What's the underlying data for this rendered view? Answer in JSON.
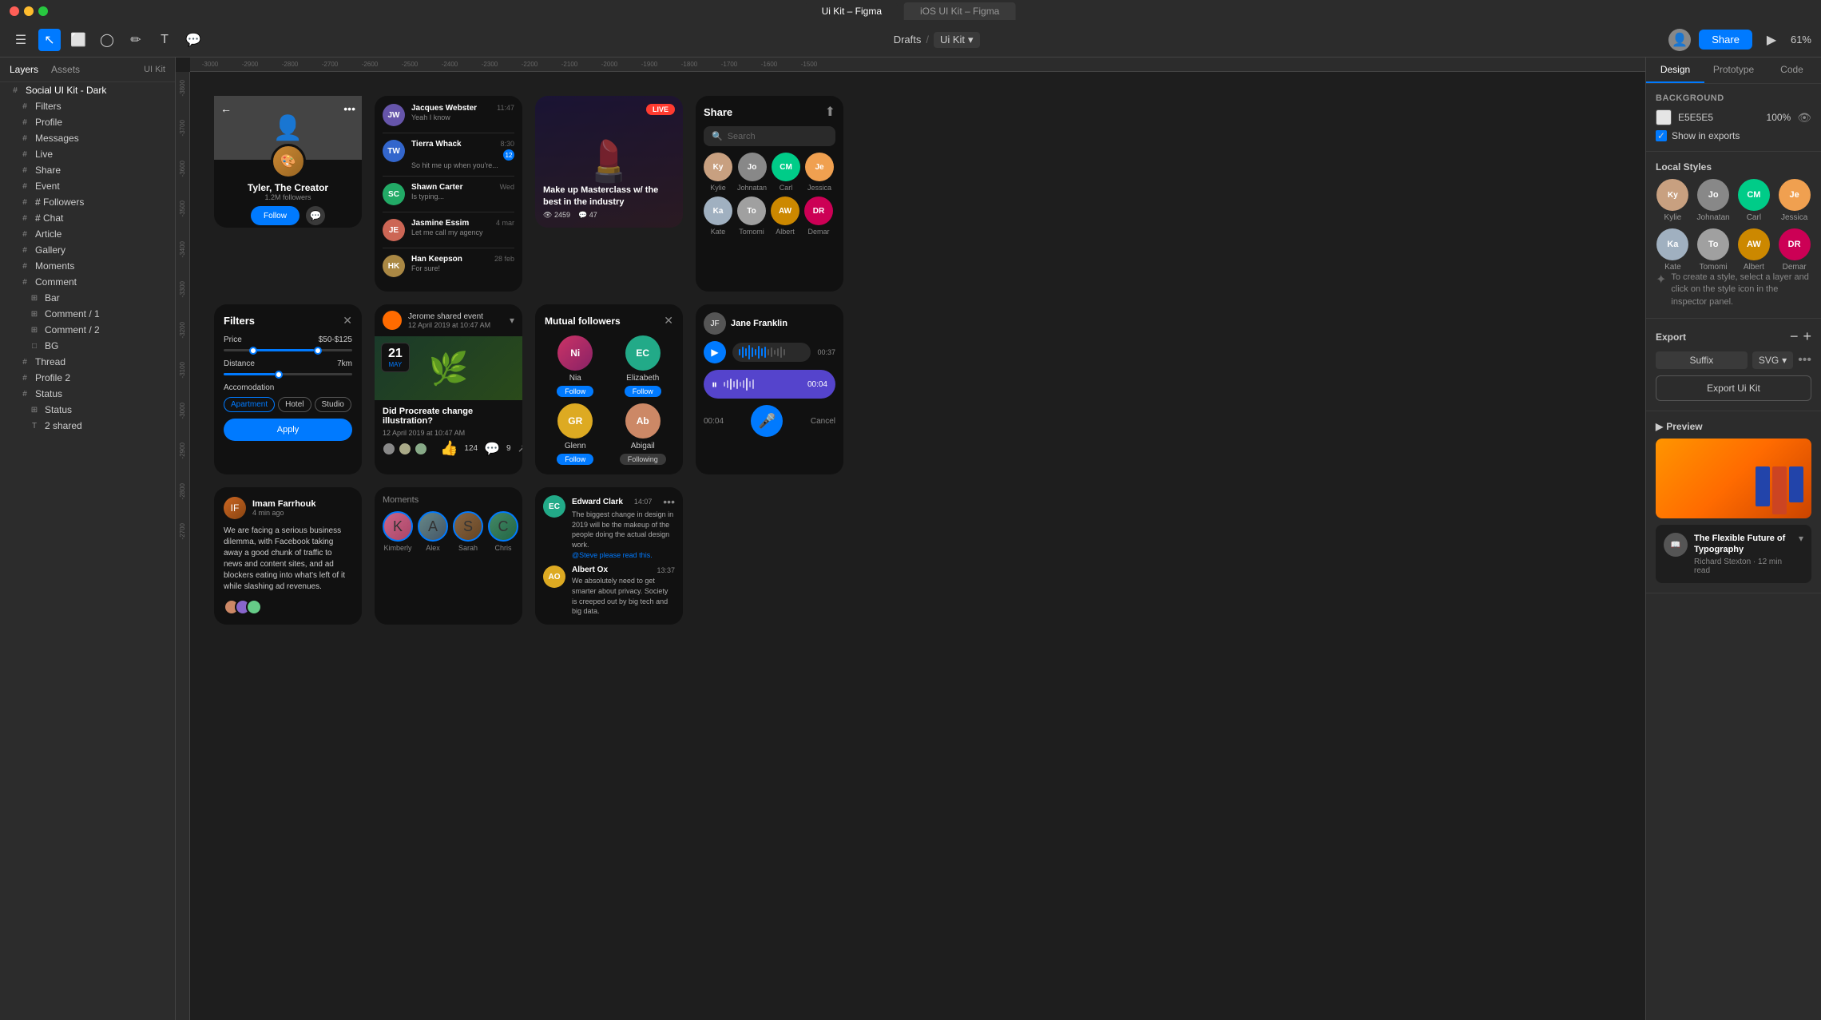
{
  "titlebar": {
    "title": "Ui Kit – Figma",
    "tab1": "Ui Kit – Figma",
    "tab2": "iOS UI Kit – Figma"
  },
  "toolbar": {
    "breadcrumb_drafts": "Drafts",
    "breadcrumb_sep": "/",
    "breadcrumb_current": "Ui Kit",
    "zoom": "61%",
    "share_btn": "Share"
  },
  "left_panel": {
    "tab_layers": "Layers",
    "tab_assets": "Assets",
    "ui_kit_label": "UI Kit",
    "root_item": "Social UI Kit - Dark",
    "items": [
      {
        "label": "Filters",
        "indent": 1
      },
      {
        "label": "Profile",
        "indent": 1
      },
      {
        "label": "Messages",
        "indent": 1
      },
      {
        "label": "Live",
        "indent": 1
      },
      {
        "label": "Share",
        "indent": 1
      },
      {
        "label": "Event",
        "indent": 1
      },
      {
        "label": "Followers",
        "indent": 1
      },
      {
        "label": "Chat",
        "indent": 1
      },
      {
        "label": "Article",
        "indent": 1
      },
      {
        "label": "Gallery",
        "indent": 1
      },
      {
        "label": "Moments",
        "indent": 1
      },
      {
        "label": "Comment",
        "indent": 1
      },
      {
        "label": "Bar",
        "indent": 2
      },
      {
        "label": "Comment / 1",
        "indent": 2
      },
      {
        "label": "Comment / 2",
        "indent": 2
      },
      {
        "label": "BG",
        "indent": 2
      },
      {
        "label": "Thread",
        "indent": 1
      },
      {
        "label": "Profile 2",
        "indent": 1
      },
      {
        "label": "Status",
        "indent": 1
      },
      {
        "label": "Status",
        "indent": 2
      },
      {
        "label": "2 shared",
        "indent": 2
      }
    ]
  },
  "right_panel": {
    "tab_design": "Design",
    "tab_prototype": "Prototype",
    "tab_code": "Code",
    "background_label": "Background",
    "bg_color": "E5E5E5",
    "bg_opacity": "100%",
    "show_exports": "Show in exports",
    "local_styles_label": "Local Styles",
    "styles_hint": "To create a style, select a layer and click on the style icon in the inspector panel.",
    "avatars": [
      {
        "name": "Kylie",
        "color": "#c8a080"
      },
      {
        "name": "Johnatan",
        "color": "#888"
      },
      {
        "name": "Carl",
        "bg": "#00cc88",
        "initials": "CM"
      },
      {
        "name": "Jessica",
        "color": "#f0a050"
      },
      {
        "name": "Kate",
        "color": "#a0b0c0"
      },
      {
        "name": "Tomomi",
        "color": "#a0a0a0"
      },
      {
        "name": "Albert",
        "bg": "#cc8800",
        "initials": "AW"
      },
      {
        "name": "Demar",
        "bg": "#cc0055",
        "initials": "DR"
      }
    ],
    "export_label": "Export",
    "suffix_label": "Suffix",
    "format_label": "SVG",
    "export_btn": "Export Ui Kit",
    "preview_label": "Preview",
    "article_title": "The Flexible Future of Typography",
    "article_meta": "Richard Stexton · 12 min read"
  },
  "canvas": {
    "rulers": [
      "-3000",
      "-2900",
      "-2800",
      "-2700",
      "-2600",
      "-2500",
      "-2400",
      "-2300",
      "-2200",
      "-2100",
      "-2000",
      "-1900",
      "-1800",
      "-1700",
      "-1600",
      "-1500"
    ],
    "profile": {
      "name": "Tyler, The Creator",
      "followers": "1.2M followers",
      "follow_btn": "Follow"
    },
    "messages": [
      {
        "name": "Jacques Webster",
        "text": "Yeah I know",
        "time": "11:47",
        "avatar_color": "#6655aa"
      },
      {
        "name": "Tierra Whack",
        "initials": "TW",
        "text": "So hit me up when you're...",
        "time": "8:30",
        "avatar_color": "#3366cc",
        "badge": "12"
      },
      {
        "name": "Shawn Carter",
        "initials": "SC",
        "text": "Is typing...",
        "time": "Wed",
        "avatar_color": "#22aa66"
      },
      {
        "name": "Jasmine Essim",
        "text": "Let me call my agency",
        "time": "4 mar",
        "avatar_color": "#cc6655"
      },
      {
        "name": "Han Keepson",
        "text": "For sure!",
        "time": "28 feb",
        "avatar_color": "#aa8844"
      }
    ],
    "live": {
      "badge": "LIVE",
      "title": "Make up Masterclass w/ the best in the industry",
      "views": "2459",
      "comments": "47"
    },
    "filters": {
      "title": "Filters",
      "price_label": "Price",
      "price_value": "$50-$125",
      "distance_label": "Distance",
      "distance_value": "7km",
      "accommodation_label": "Accomodation",
      "chips": [
        "Apartment",
        "Hotel",
        "Studio"
      ],
      "apply_btn": "Apply"
    },
    "event": {
      "author": "Jerome shared event",
      "date": "12 April 2019 at 10:47 AM",
      "day": "21",
      "month": "May",
      "title": "Did Procreate change illustration?",
      "meta": "12 April 2019 at 10:47 AM",
      "likes": "124",
      "comments": "9"
    },
    "mutual": {
      "title": "Mutual followers",
      "followers": [
        {
          "name": "Nia",
          "color": "#cc3366",
          "type": "image"
        },
        {
          "name": "Elizabeth",
          "initials": "EC",
          "color": "#22aa88"
        },
        {
          "name": "Glenn",
          "initials": "GR",
          "color": "#ddaa22"
        },
        {
          "name": "Abigail",
          "color": "#cc8866",
          "type": "image"
        }
      ]
    },
    "chat": {
      "author": "Edward Clark",
      "initials": "EC",
      "time": "14:07",
      "text": "The biggest change in design in 2019 will be the makeup of the people doing the actual design work.",
      "mention": "@Steve please read this.",
      "author2": "Albert Ox",
      "time2": "13:37",
      "text2": "We absolutely need to get smarter about privacy. Society is creeped out by big tech and big data."
    },
    "moments": {
      "label": "Moments",
      "people": [
        {
          "name": "Kimberly"
        },
        {
          "name": "Alex"
        },
        {
          "name": "Sarah"
        },
        {
          "name": "Chris"
        }
      ]
    },
    "thread_post": {
      "author": "Imam Farrhouk",
      "time": "4 min ago",
      "text": "We are facing a serious business dilemma, with Facebook taking away a good chunk of traffic to news and content sites, and ad blockers eating into what's left of it while slashing ad revenues."
    },
    "share": {
      "title": "Share",
      "search_placeholder": "Search",
      "people": [
        {
          "name": "Kylie"
        },
        {
          "name": "Johnatan"
        },
        {
          "name": "Carl",
          "initials": "CM",
          "bg": "#00cc88"
        },
        {
          "name": "Jessica"
        },
        {
          "name": "Kate"
        },
        {
          "name": "Tomomi"
        },
        {
          "name": "Albert",
          "initials": "AW",
          "bg": "#cc8800"
        },
        {
          "name": "Demar",
          "initials": "DR",
          "bg": "#cc0055"
        }
      ]
    },
    "audio": {
      "user": "Jane Franklin",
      "time1": "00:37",
      "time2": "00:04",
      "cancel": "Cancel"
    }
  }
}
